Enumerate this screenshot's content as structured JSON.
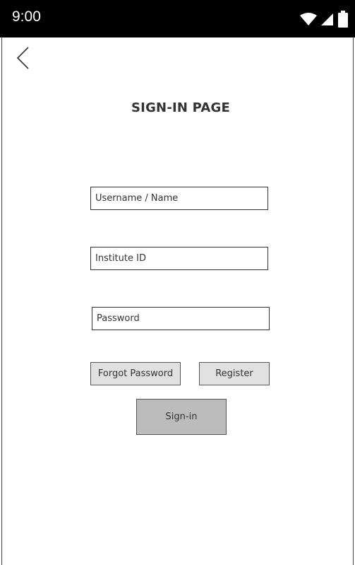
{
  "status_bar": {
    "time": "9:00",
    "icons": [
      "wifi-icon",
      "cell-signal-icon",
      "battery-icon"
    ]
  },
  "nav": {
    "back_icon": "chevron-left-icon"
  },
  "page": {
    "title": "SIGN-IN PAGE"
  },
  "form": {
    "username": {
      "placeholder": "Username / Name",
      "value": ""
    },
    "institute_id": {
      "placeholder": "Institute ID",
      "value": ""
    },
    "password": {
      "placeholder": "Password",
      "value": ""
    }
  },
  "buttons": {
    "forgot_password": "Forgot Password",
    "register": "Register",
    "sign_in": "Sign-in"
  },
  "colors": {
    "status_bar_bg": "#000000",
    "button_light": "#e1e1e1",
    "button_dark": "#bcbcbc",
    "text": "#333333"
  }
}
